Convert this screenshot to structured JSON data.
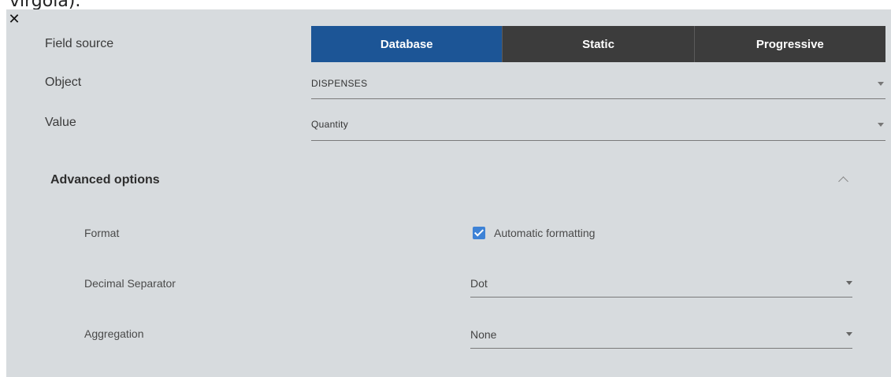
{
  "top_text": "virgola).",
  "close_icon": "close-icon",
  "field_source": {
    "label": "Field source",
    "options": [
      "Database",
      "Static",
      "Progressive"
    ],
    "selected": "Database"
  },
  "object": {
    "label": "Object",
    "value": "DISPENSES"
  },
  "value": {
    "label": "Value",
    "value": "Quantity"
  },
  "advanced": {
    "title": "Advanced options",
    "expanded": true,
    "format": {
      "label": "Format",
      "checkbox_label": "Automatic formatting",
      "checked": true
    },
    "decimal_separator": {
      "label": "Decimal Separator",
      "value": "Dot"
    },
    "aggregation": {
      "label": "Aggregation",
      "value": "None"
    }
  },
  "colors": {
    "panel_bg": "#d7dbde",
    "active_segment": "#1c5596",
    "inactive_segment": "#3c3c3c",
    "checkbox": "#3d82d6"
  }
}
